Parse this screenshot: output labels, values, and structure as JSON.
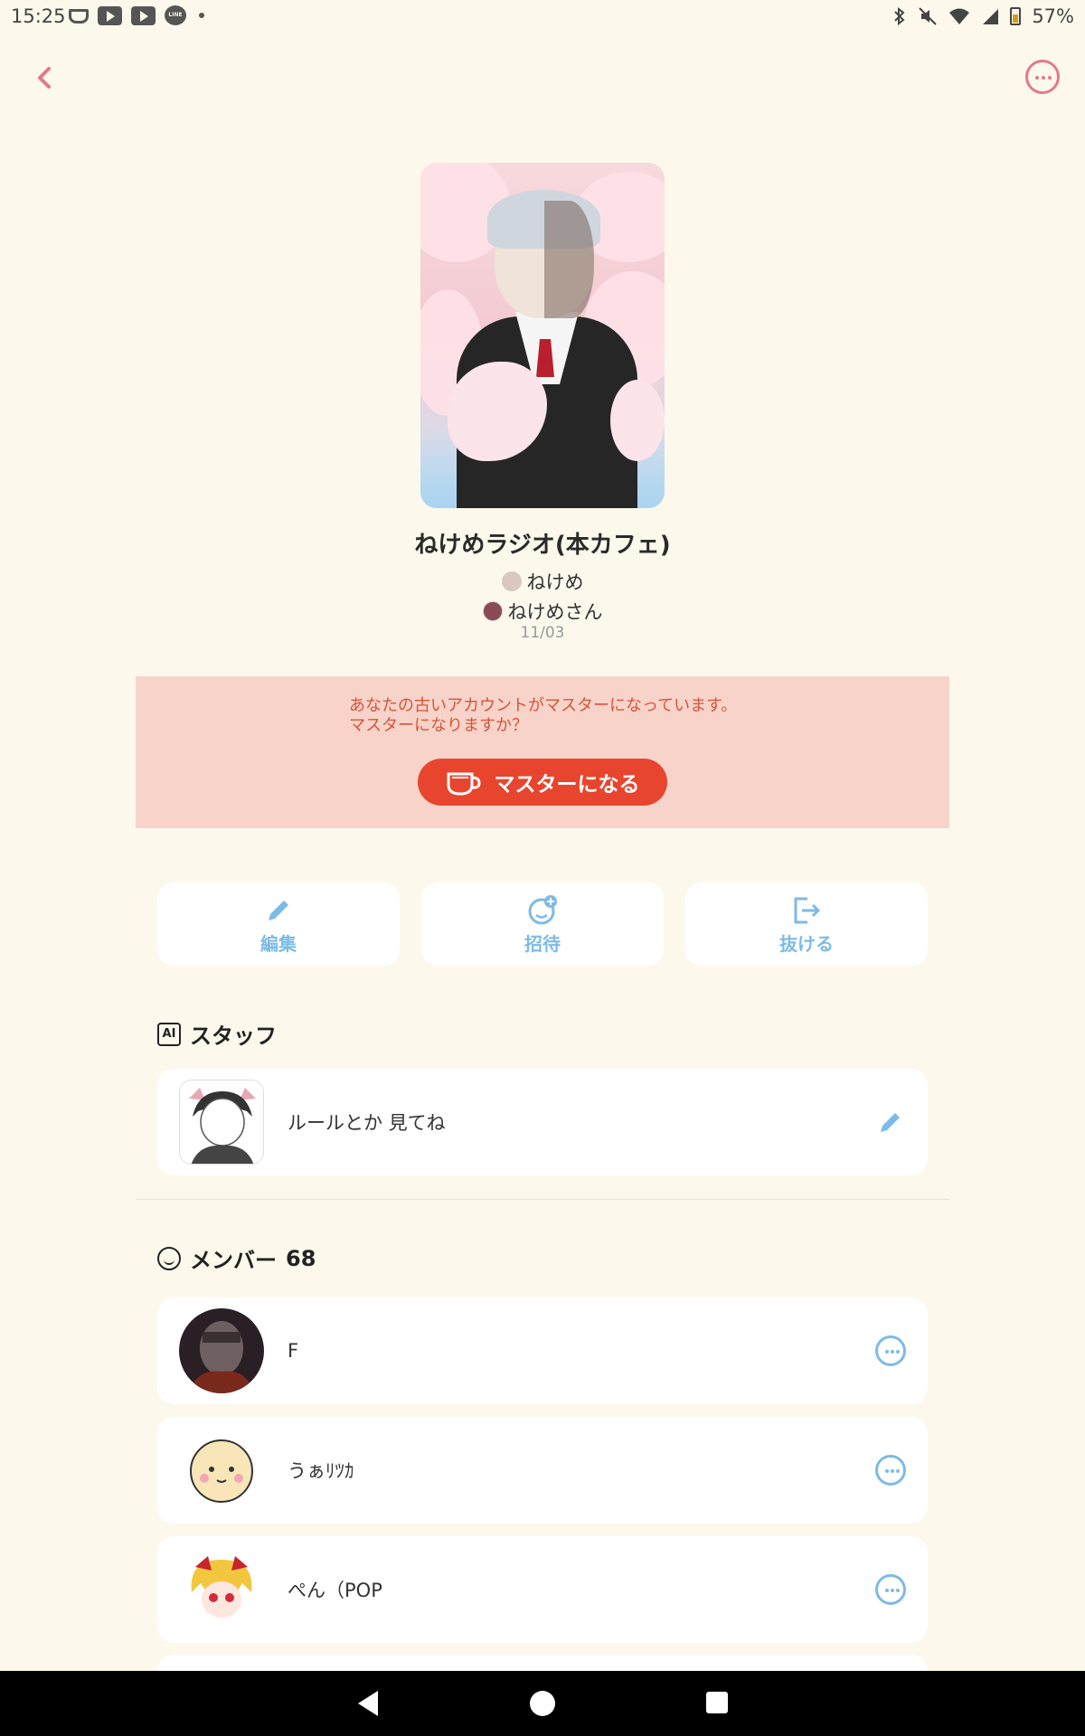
{
  "status_bar": {
    "time": "15:25",
    "battery": "57%",
    "app_icons": [
      "cup-icon",
      "youtube-icon",
      "youtube-icon",
      "line-icon"
    ],
    "line_label": "LINE"
  },
  "cafe": {
    "title": "ねけめラジオ(本カフェ)",
    "owners": [
      "ねけめ",
      "ねけめさん"
    ],
    "date": "11/03"
  },
  "notice": {
    "line1": "あなたの古いアカウントがマスターになっています。",
    "line2": "マスターになりますか？",
    "button_label": "マスターになる"
  },
  "actions": [
    {
      "label": "編集",
      "icon": "pencil-icon"
    },
    {
      "label": "招待",
      "icon": "invite-icon"
    },
    {
      "label": "抜ける",
      "icon": "exit-icon"
    }
  ],
  "staff": {
    "heading": "スタッフ",
    "ai_badge": "AI",
    "items": [
      {
        "name": "ルールとか 見てね"
      }
    ]
  },
  "members": {
    "heading": "メンバー",
    "count": "68",
    "items": [
      {
        "name": "F"
      },
      {
        "name": "うぁﾘﾂｶ"
      },
      {
        "name": "ぺん（POP"
      }
    ]
  },
  "colors": {
    "background": "#fdf8ec",
    "accent_pink": "#e27a8a",
    "accent_blue": "#7dbbe6",
    "notice_bg": "#f8d3c9",
    "master_button": "#e8452f"
  }
}
